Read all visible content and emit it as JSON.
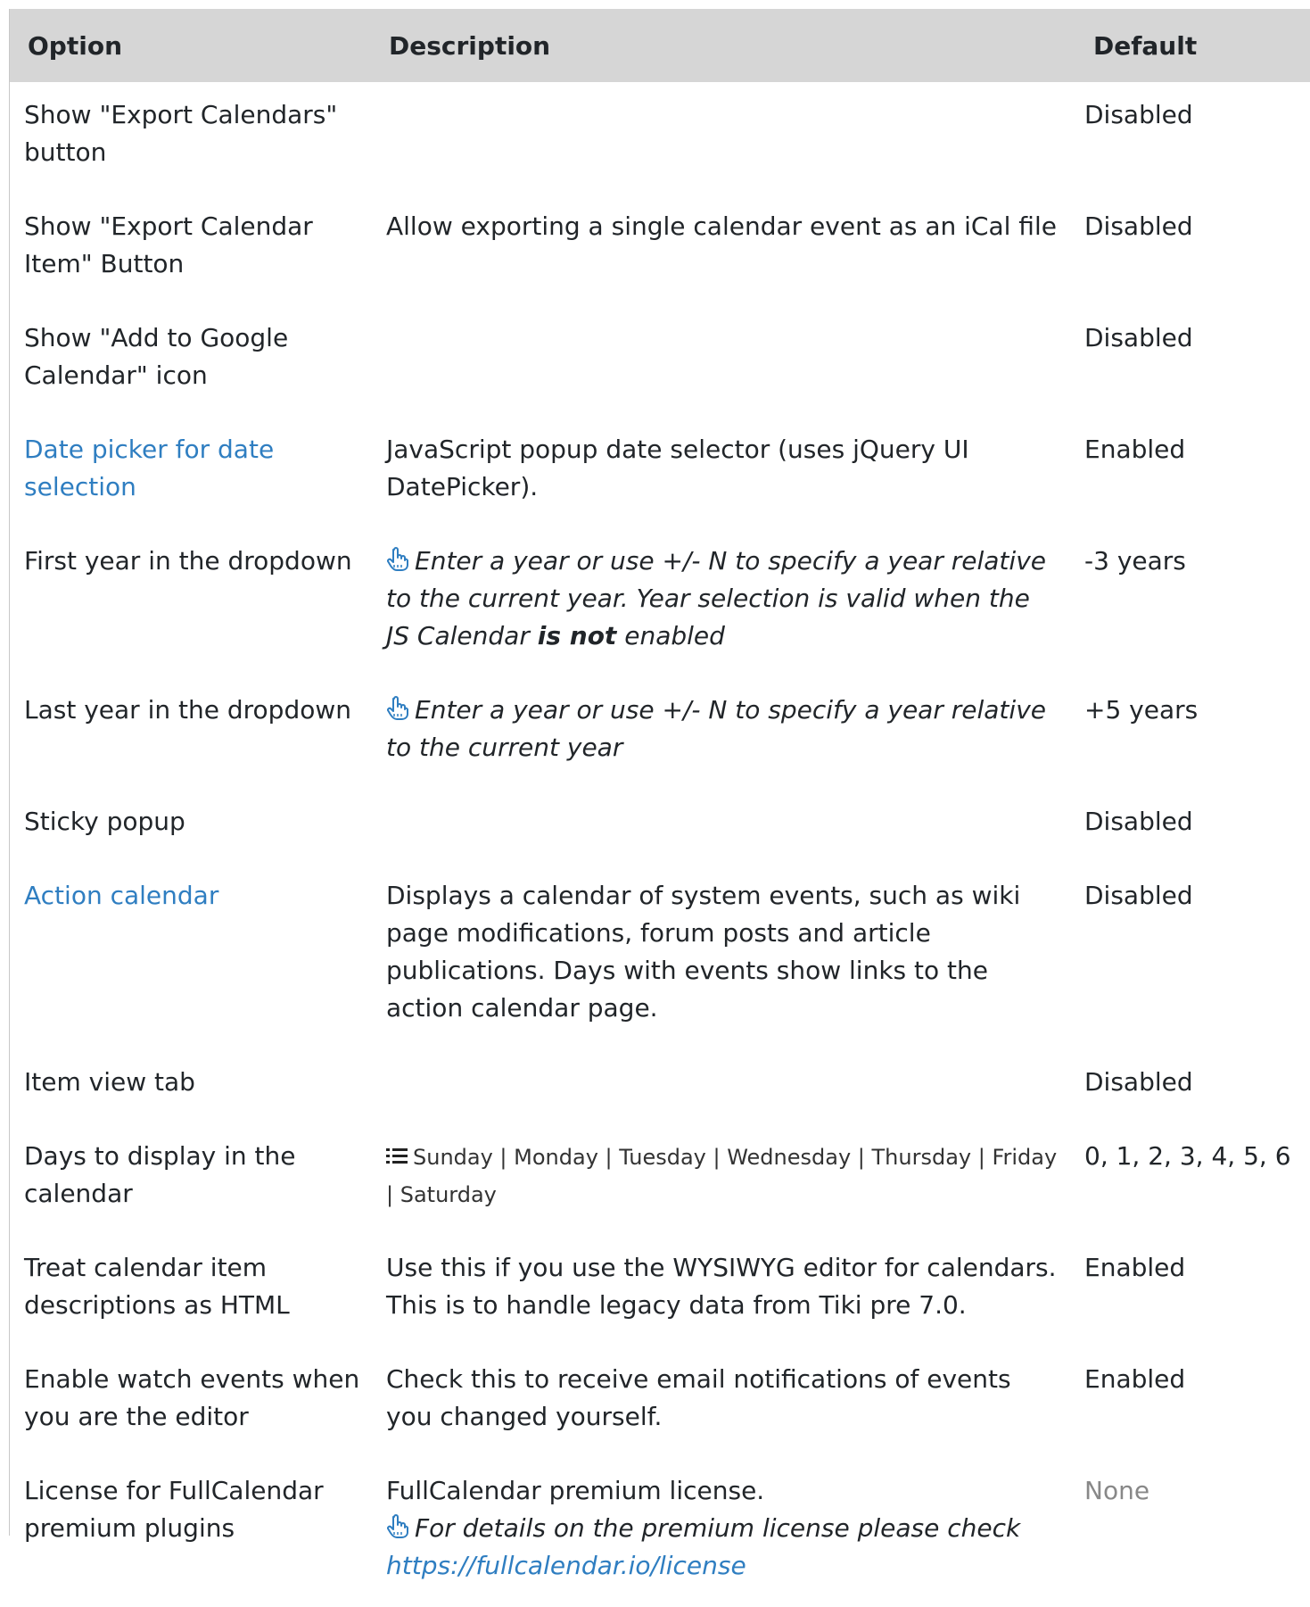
{
  "headers": {
    "option": "Option",
    "description": "Description",
    "default": "Default"
  },
  "rows": [
    {
      "option": "Show \"Export Calendars\" button",
      "description": "",
      "default": "Disabled"
    },
    {
      "option": "Show \"Export Calendar Item\" Button",
      "description": "Allow exporting a single calendar event as an iCal file",
      "default": "Disabled"
    },
    {
      "option": "Show \"Add to Google Calendar\" icon",
      "description": "",
      "default": "Disabled"
    },
    {
      "option": "Date picker for date selection",
      "description": "JavaScript popup date selector (uses jQuery UI DatePicker).",
      "default": "Enabled"
    },
    {
      "option": "First year in the dropdown",
      "hint_pre": "Enter a year or use +/- N to specify a year relative to the current year. Year selection is valid when the JS Calendar ",
      "hint_bold": "is not",
      "hint_post": " enabled",
      "default": "-3 years"
    },
    {
      "option": "Last year in the dropdown",
      "hint": "Enter a year or use +/- N to specify a year relative to the current year",
      "default": "+5 years"
    },
    {
      "option": "Sticky popup",
      "description": "",
      "default": "Disabled"
    },
    {
      "option": "Action calendar",
      "description": "Displays a calendar of system events, such as wiki page modifications, forum posts and article publications. Days with events show links to the action calendar page.",
      "default": "Disabled"
    },
    {
      "option": "Item view tab",
      "description": "",
      "default": "Disabled"
    },
    {
      "option": "Days to display in the calendar",
      "options_list": "Sunday | Monday | Tuesday | Wednesday | Thursday | Friday | Saturday",
      "default": "0, 1, 2, 3, 4, 5, 6"
    },
    {
      "option": "Treat calendar item descriptions as HTML",
      "description": "Use this if you use the WYSIWYG editor for calendars. This is to handle legacy data from Tiki pre 7.0.",
      "default": "Enabled"
    },
    {
      "option": "Enable watch events when you are the editor",
      "description": "Check this to receive email notifications of events you changed yourself.",
      "default": "Enabled"
    },
    {
      "option": "License for FullCalendar premium plugins",
      "description": "FullCalendar premium license.",
      "hint": "For details on the premium license please check ",
      "hint_link": "https://fullcalendar.io/license",
      "default": "None"
    }
  ],
  "colors": {
    "header_bg": "#d6d6d6",
    "link": "#2f7ec1",
    "muted": "#888888",
    "hint_icon": "#2f7ec1"
  },
  "icons": {
    "hint": "pointing-hand-icon",
    "list": "list-icon"
  }
}
